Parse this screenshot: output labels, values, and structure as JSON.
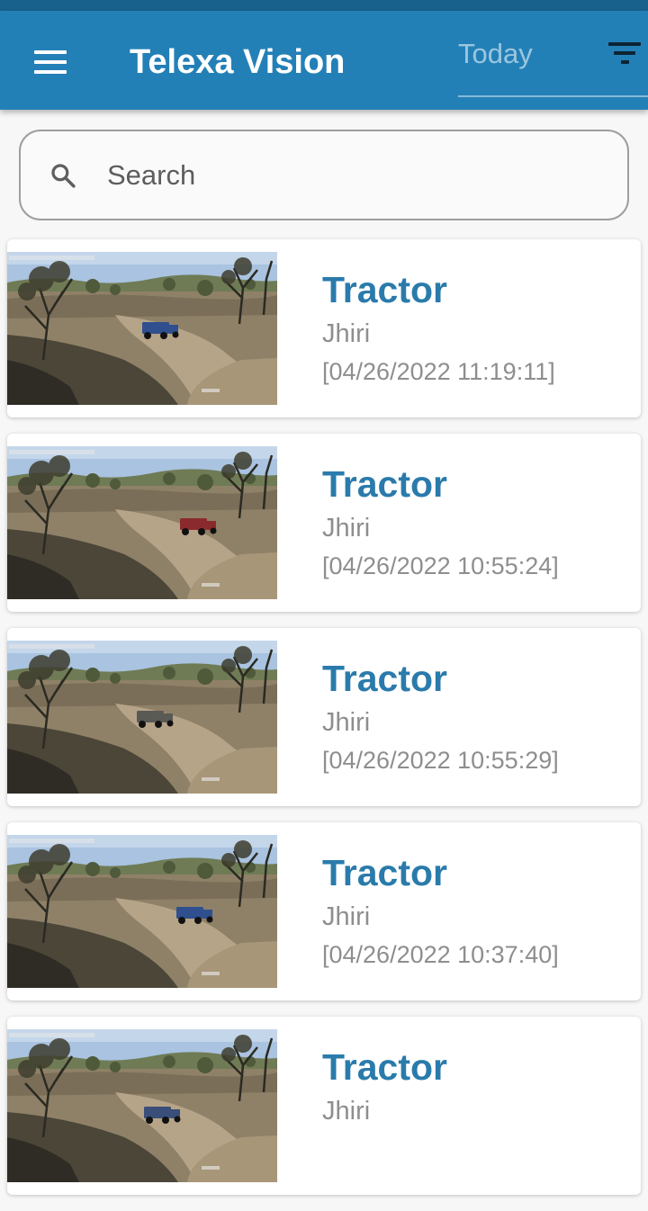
{
  "app_bar": {
    "title": "Telexa Vision",
    "date_filter": "Today",
    "menu_icon": "menu-icon",
    "filter_icon": "filter-icon"
  },
  "search": {
    "placeholder": "Search",
    "icon": "search-icon"
  },
  "detections": [
    {
      "title": "Tractor",
      "location": "Jhiri",
      "timestamp": "[04/26/2022 11:19:11]",
      "vehicle_color": "#2f4f8e"
    },
    {
      "title": "Tractor",
      "location": "Jhiri",
      "timestamp": "[04/26/2022 10:55:24]",
      "vehicle_color": "#8b2a2e"
    },
    {
      "title": "Tractor",
      "location": "Jhiri",
      "timestamp": "[04/26/2022 10:55:29]",
      "vehicle_color": "#5a5a55"
    },
    {
      "title": "Tractor",
      "location": "Jhiri",
      "timestamp": "[04/26/2022 10:37:40]",
      "vehicle_color": "#2f4f8e"
    },
    {
      "title": "Tractor",
      "location": "Jhiri",
      "timestamp": "",
      "vehicle_color": "#3a4e7a"
    }
  ],
  "colors": {
    "app_bar": "#2380b7",
    "status_bar": "#17618c",
    "title_accent": "#2a7bab",
    "muted_text": "#8e8e8e"
  }
}
